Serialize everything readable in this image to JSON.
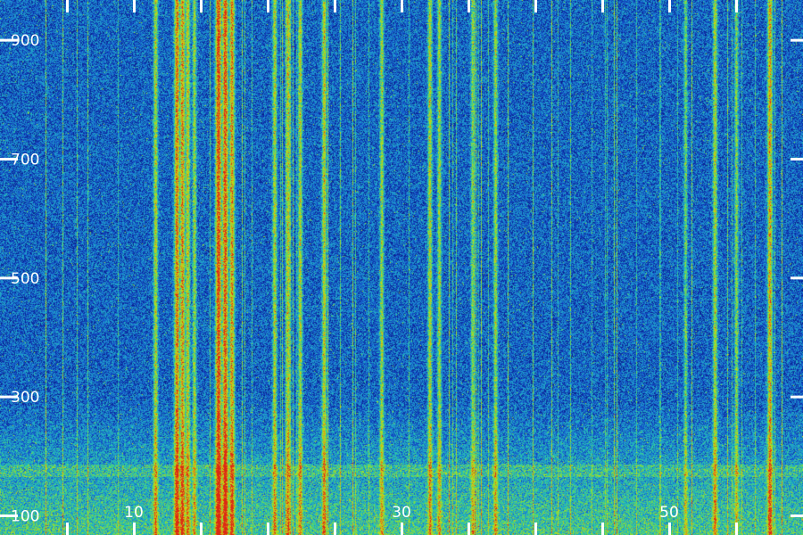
{
  "chart_data": {
    "type": "heatmap",
    "title": "",
    "xlabel": "",
    "ylabel": "",
    "xlim": [
      0,
      60
    ],
    "ylim": [
      100,
      1000
    ],
    "x_ticks": [
      {
        "value": 10,
        "label": "10"
      },
      {
        "value": 30,
        "label": "30"
      },
      {
        "value": 50,
        "label": "50"
      }
    ],
    "y_ticks": [
      {
        "value": 100,
        "label": "100"
      },
      {
        "value": 300,
        "label": "300"
      },
      {
        "value": 500,
        "label": "500"
      },
      {
        "value": 700,
        "label": "700"
      },
      {
        "value": 900,
        "label": "900"
      }
    ],
    "x_minor_ticks": [
      5,
      10,
      15,
      20,
      25,
      30,
      35,
      40,
      45,
      50,
      55
    ],
    "colormap": [
      "#000a3c",
      "#0a1e8c",
      "#1450c8",
      "#1e96d2",
      "#28c8aa",
      "#82dc3c",
      "#c8dc14",
      "#dc9614",
      "#dc2814"
    ],
    "background_color": "#0a1466",
    "tick_color": "#ffffff",
    "bright_columns": [
      {
        "x": 11.6,
        "intensity": 0.55,
        "note_low": true
      },
      {
        "x": 13.2,
        "intensity": 0.8
      },
      {
        "x": 13.6,
        "intensity": 0.75
      },
      {
        "x": 14.0,
        "intensity": 0.6
      },
      {
        "x": 14.5,
        "intensity": 0.5
      },
      {
        "x": 16.3,
        "intensity": 0.95
      },
      {
        "x": 16.8,
        "intensity": 0.9
      },
      {
        "x": 17.3,
        "intensity": 0.75
      },
      {
        "x": 20.5,
        "intensity": 0.55
      },
      {
        "x": 21.5,
        "intensity": 0.6
      },
      {
        "x": 22.4,
        "intensity": 0.55
      },
      {
        "x": 24.2,
        "intensity": 0.6
      },
      {
        "x": 28.5,
        "intensity": 0.5
      },
      {
        "x": 32.1,
        "intensity": 0.55
      },
      {
        "x": 32.8,
        "intensity": 0.5
      },
      {
        "x": 35.3,
        "intensity": 0.45
      },
      {
        "x": 37.0,
        "intensity": 0.5
      },
      {
        "x": 51.2,
        "intensity": 0.4
      },
      {
        "x": 53.4,
        "intensity": 0.55
      },
      {
        "x": 55.0,
        "intensity": 0.45
      },
      {
        "x": 57.5,
        "intensity": 0.7
      }
    ]
  }
}
